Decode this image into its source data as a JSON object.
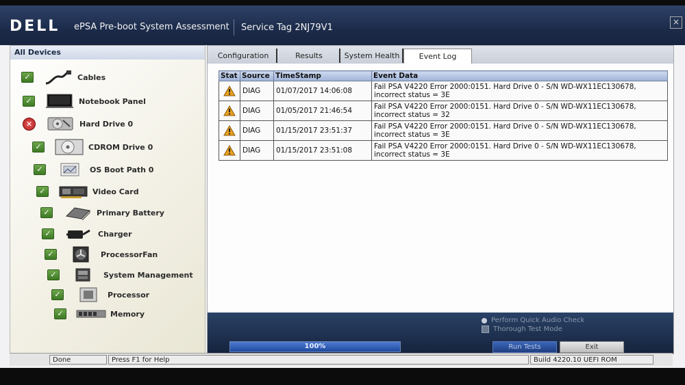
{
  "titlebar": {
    "logo": "DELL",
    "app_title": "ePSA Pre-boot System Assessment",
    "service_tag": "Service Tag 2NJ79V1",
    "close": "×"
  },
  "sidebar": {
    "header": "All Devices",
    "devices": [
      {
        "label": "Cables",
        "status": "pass",
        "icon": "cable-icon"
      },
      {
        "label": "Notebook Panel",
        "status": "pass",
        "icon": "laptop-panel-icon"
      },
      {
        "label": "Hard Drive 0",
        "status": "fail",
        "icon": "hard-drive-icon"
      },
      {
        "label": "CDROM Drive 0",
        "status": "pass",
        "icon": "cdrom-icon"
      },
      {
        "label": "OS Boot Path 0",
        "status": "pass",
        "icon": "boot-path-icon"
      },
      {
        "label": "Video Card",
        "status": "pass",
        "icon": "video-card-icon"
      },
      {
        "label": "Primary Battery",
        "status": "pass",
        "icon": "battery-icon"
      },
      {
        "label": "Charger",
        "status": "pass",
        "icon": "charger-icon"
      },
      {
        "label": "ProcessorFan",
        "status": "pass",
        "icon": "fan-icon"
      },
      {
        "label": "System Management",
        "status": "pass",
        "icon": "system-management-icon"
      },
      {
        "label": "Processor",
        "status": "pass",
        "icon": "processor-icon"
      },
      {
        "label": "Memory",
        "status": "pass",
        "icon": "memory-icon"
      }
    ]
  },
  "tabs": [
    {
      "label": "Configuration",
      "active": false
    },
    {
      "label": "Results",
      "active": false
    },
    {
      "label": "System Health",
      "active": false
    },
    {
      "label": "Event Log",
      "active": true
    }
  ],
  "event_log": {
    "columns": [
      "Stat",
      "Source",
      "TimeStamp",
      "Event Data"
    ],
    "rows": [
      {
        "stat": "warning",
        "source": "DIAG",
        "timestamp": "01/07/2017 14:06:08",
        "event": "Fail PSA V4220 Error 2000:0151.  Hard Drive 0 - S/N WD-WX11EC130678, incorrect status = 3E"
      },
      {
        "stat": "warning",
        "source": "DIAG",
        "timestamp": "01/05/2017 21:46:54",
        "event": "Fail PSA V4220 Error 2000:0151.  Hard Drive 0 - S/N WD-WX11EC130678, incorrect status = 32"
      },
      {
        "stat": "warning",
        "source": "DIAG",
        "timestamp": "01/15/2017 23:51:37",
        "event": "Fail PSA V4220 Error 2000:0151.  Hard Drive 0 - S/N WD-WX11EC130678, incorrect status = 3E"
      },
      {
        "stat": "warning",
        "source": "DIAG",
        "timestamp": "01/15/2017 23:51:08",
        "event": "Fail PSA V4220 Error 2000:0151.  Hard Drive 0 - S/N WD-WX11EC130678, incorrect status = 3E"
      }
    ]
  },
  "controls": {
    "progress_label": "100%",
    "progress_value": 100,
    "option_audio": "Perform Quick Audio Check",
    "option_thorough": "Thorough Test Mode",
    "run_tests": "Run Tests",
    "exit": "Exit"
  },
  "statusbar": {
    "state": "Done",
    "help": "Press F1 for Help",
    "build": "Build  4220.10 UEFI ROM"
  },
  "colors": {
    "titlebar": "#1c2b4a",
    "pass": "#3d7a25",
    "fail": "#b3201f",
    "warning": "#e8a020"
  }
}
